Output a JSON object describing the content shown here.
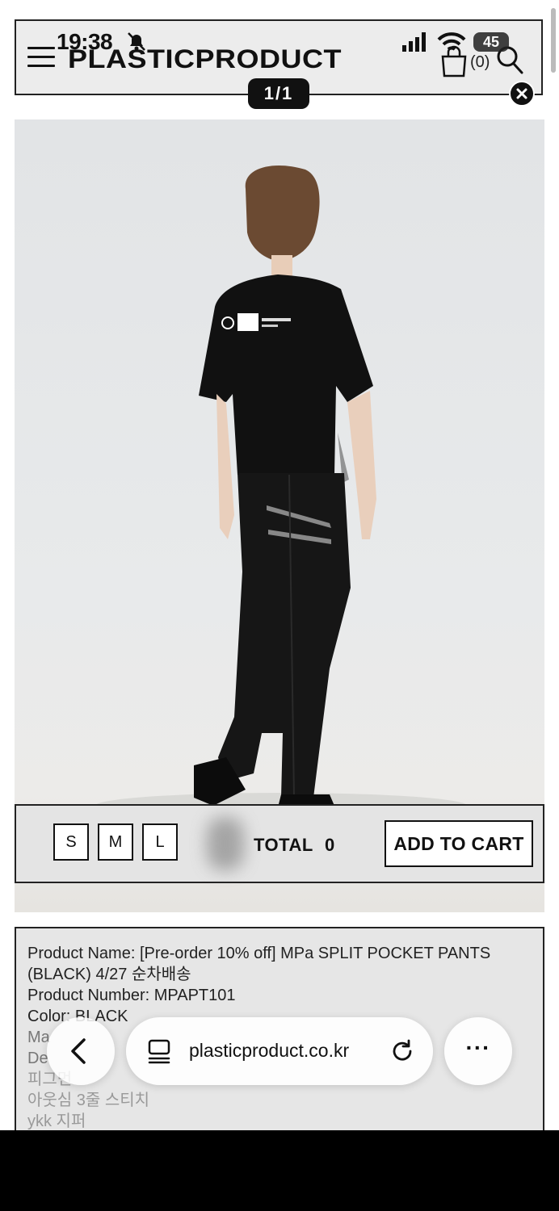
{
  "status_bar": {
    "time": "19:38",
    "battery": "45"
  },
  "header": {
    "logo": "PLASTICPRODUCT",
    "cart_count": "(0)"
  },
  "gallery": {
    "counter": "1/1"
  },
  "options": {
    "sizes": [
      "S",
      "M",
      "L"
    ],
    "total_label": "TOTAL",
    "total_value": "0",
    "add_to_cart": "ADD TO CART"
  },
  "description": {
    "lines": [
      "Product Name: [Pre-order 10% off] MPa SPLIT POCKET PANTS",
      "(BLACK) 4/27 순차배송",
      "Product Number: MPAPT101",
      "Color: BLACK",
      "Ma",
      "De",
      "피그먼",
      "아웃심 3줄 스티치",
      "ykk 지퍼"
    ]
  },
  "browser": {
    "url": "plasticproduct.co.kr",
    "more": "···"
  },
  "colors": {
    "accent": "#111111",
    "background": "#ececec"
  }
}
